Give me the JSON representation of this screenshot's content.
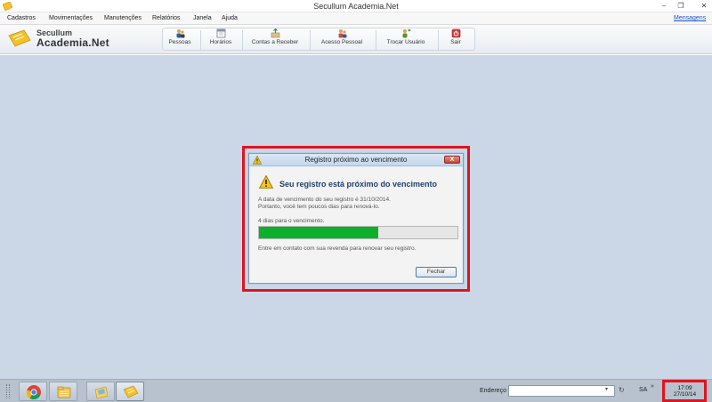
{
  "window": {
    "title": "Secullum  Academia.Net",
    "minimize": "–",
    "restore": "❐",
    "close": "✕"
  },
  "menu": {
    "items": [
      "Cadastros",
      "Movimentações",
      "Manutenções",
      "Relatórios",
      "Janela",
      "Ajuda"
    ],
    "messages_link": "Mensagens"
  },
  "logo": {
    "line1": "Secullum",
    "line2": "Academia.Net"
  },
  "toolbar": {
    "buttons": [
      {
        "label": "Pessoas",
        "icon": "people-icon"
      },
      {
        "label": "Horários",
        "icon": "schedule-icon"
      },
      {
        "label": "Contas a Receber",
        "icon": "receivables-icon"
      },
      {
        "label": "Acesso Pessoal",
        "icon": "access-icon"
      },
      {
        "label": "Trocar Usuário",
        "icon": "switch-user-icon"
      },
      {
        "label": "Sair",
        "icon": "exit-icon"
      }
    ]
  },
  "dialog": {
    "title": "Registro próximo ao vencimento",
    "heading": "Seu registro está próximo do vencimento",
    "line1": "A data de vencimento do seu registro é 31/10/2014.",
    "line2": "Portanto, você tem poucos dias para renová-lo.",
    "days_text": "4   dias para o vencimento.",
    "progress_fraction": 0.6,
    "contact_text": "Entre em contato com sua revenda para renovar seu registro.",
    "close_button": "Fechar",
    "close_x": "X"
  },
  "taskbar": {
    "apps": [
      "chrome-icon",
      "file-explorer-icon",
      "windows-explorer-icon",
      "academia-app-icon"
    ],
    "address_label": "Endereço",
    "address_value": "",
    "dropdown_glyph": "▾",
    "refresh_glyph": "↻",
    "language": "SA",
    "tray_chevron": "»",
    "clock_time": "17:09",
    "clock_date": "27/10/14"
  },
  "colors": {
    "workspace": "#cbd7e7",
    "highlight": "#e0141f",
    "progress": "#0db02b"
  }
}
